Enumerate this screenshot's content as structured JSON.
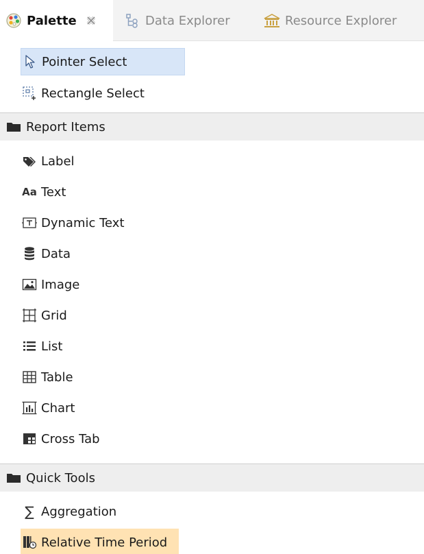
{
  "tabs": [
    {
      "label": "Palette",
      "icon": "palette-icon",
      "active": true
    },
    {
      "label": "Data Explorer",
      "icon": "data-explorer-icon",
      "active": false
    },
    {
      "label": "Resource Explorer",
      "icon": "resource-explorer-icon",
      "active": false
    }
  ],
  "tools": [
    {
      "label": "Pointer Select",
      "icon": "pointer-icon",
      "selected": true
    },
    {
      "label": "Rectangle Select",
      "icon": "rectangle-select-icon",
      "selected": false
    }
  ],
  "drawers": {
    "report_items": {
      "label": "Report Items",
      "icon": "folder-icon",
      "items": [
        {
          "label": "Label",
          "icon": "label-tag-icon"
        },
        {
          "label": "Text",
          "icon": "text-aa-icon",
          "icon_text": "Aa"
        },
        {
          "label": "Dynamic Text",
          "icon": "dynamic-text-icon"
        },
        {
          "label": "Data",
          "icon": "database-icon"
        },
        {
          "label": "Image",
          "icon": "image-icon"
        },
        {
          "label": "Grid",
          "icon": "grid-icon"
        },
        {
          "label": "List",
          "icon": "list-icon"
        },
        {
          "label": "Table",
          "icon": "table-icon"
        },
        {
          "label": "Chart",
          "icon": "chart-icon"
        },
        {
          "label": "Cross Tab",
          "icon": "cross-tab-icon"
        }
      ]
    },
    "quick_tools": {
      "label": "Quick Tools",
      "icon": "folder-icon",
      "items": [
        {
          "label": "Aggregation",
          "icon": "sigma-icon",
          "icon_text": "∑"
        },
        {
          "label": "Relative Time Period",
          "icon": "relative-time-icon",
          "selected": true
        }
      ]
    }
  },
  "colors": {
    "selection_blue": "#d8e6f8",
    "selection_orange": "#ffe2b3",
    "drawer_bg": "#eeeeee",
    "tabbar_bg": "#f3f3f3"
  }
}
